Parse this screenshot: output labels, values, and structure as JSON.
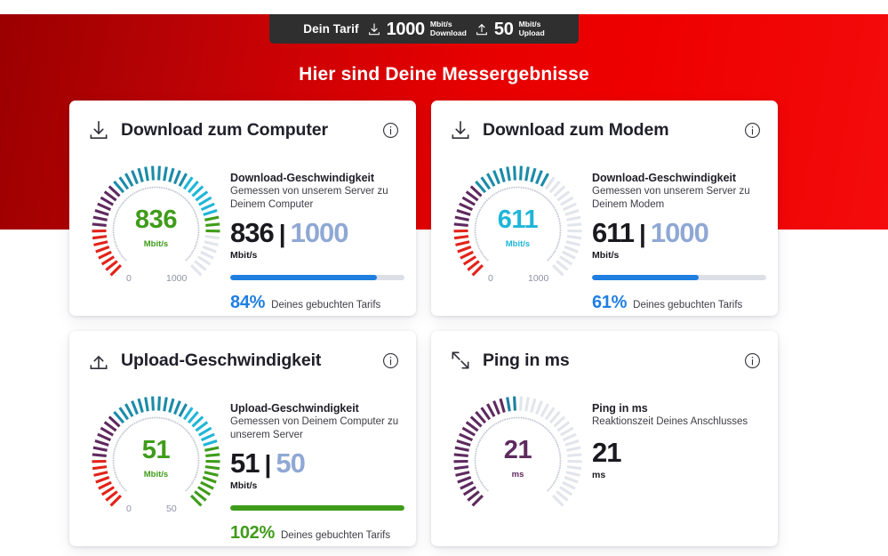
{
  "banner": {
    "tariff_label": "Dein Tarif",
    "download_icon": "download-icon",
    "download_value": "1000",
    "download_unit": "Mbit/s",
    "download_unit_label": "Download",
    "upload_icon": "upload-icon",
    "upload_value": "50",
    "upload_unit": "Mbit/s",
    "upload_unit_label": "Upload"
  },
  "headline": "Hier sind Deine Messergebnisse",
  "colors": {
    "brand_red": "#e60000",
    "banner_dark": "#2f2f2f",
    "blue": "#1f7fe0",
    "green": "#3f9c1a",
    "cyan": "#1fb6d8",
    "purple": "#5e2a5e",
    "max_grey_blue": "#8fa8d4"
  },
  "cards": [
    {
      "id": "download-computer",
      "icon": "download-icon",
      "title": "Download zum Computer",
      "info_icon": "info-icon",
      "gauge": {
        "value": "836",
        "unit": "Mbit/s",
        "min": "0",
        "max": "1000",
        "value_color": "#3f9c1a",
        "unit_color": "#3f9c1a",
        "fill_ratio": 0.836
      },
      "detail_title": "Download-Geschwindigkeit",
      "detail_sub": "Gemessen von unserem Server zu Deinem Computer",
      "value": "836",
      "separator": "|",
      "max_value": "1000",
      "unit": "Mbit/s",
      "progress_pct": 84,
      "progress_color": "#1f7fe0",
      "percent": "84%",
      "percent_color": "#1f7fe0",
      "percent_label": "Deines gebuchten Tarifs"
    },
    {
      "id": "download-modem",
      "icon": "download-icon",
      "title": "Download zum Modem",
      "info_icon": "info-icon",
      "gauge": {
        "value": "611",
        "unit": "Mbit/s",
        "min": "0",
        "max": "1000",
        "value_color": "#1fb6d8",
        "unit_color": "#1fb6d8",
        "fill_ratio": 0.611
      },
      "detail_title": "Download-Geschwindigkeit",
      "detail_sub": "Gemessen von unserem Server zu Deinem Modem",
      "value": "611",
      "separator": "|",
      "max_value": "1000",
      "unit": "Mbit/s",
      "progress_pct": 61,
      "progress_color": "#1f7fe0",
      "percent": "61%",
      "percent_color": "#1f7fe0",
      "percent_label": "Deines gebuchten Tarifs"
    },
    {
      "id": "upload-speed",
      "icon": "upload-icon",
      "title": "Upload-Geschwindigkeit",
      "info_icon": "info-icon",
      "gauge": {
        "value": "51",
        "unit": "Mbit/s",
        "min": "0",
        "max": "50",
        "value_color": "#3f9c1a",
        "unit_color": "#3f9c1a",
        "fill_ratio": 1.0
      },
      "detail_title": "Upload-Geschwindigkeit",
      "detail_sub": "Gemessen von Deinem Computer zu unserem Server",
      "value": "51",
      "separator": "|",
      "max_value": "50",
      "unit": "Mbit/s",
      "progress_pct": 100,
      "progress_color": "#3f9c1a",
      "percent": "102%",
      "percent_color": "#3f9c1a",
      "percent_label": "Deines gebuchten Tarifs"
    },
    {
      "id": "ping",
      "icon": "ping-arrows-icon",
      "title": "Ping in ms",
      "info_icon": "info-icon",
      "gauge": {
        "value": "21",
        "unit": "ms",
        "min": "",
        "max": "",
        "value_color": "#5e2a5e",
        "unit_color": "#5e2a5e",
        "fill_ratio": 0.5
      },
      "detail_title": "Ping in ms",
      "detail_sub": "Reaktionszeit Deines Anschlusses",
      "value": "21",
      "unit": "ms"
    }
  ]
}
